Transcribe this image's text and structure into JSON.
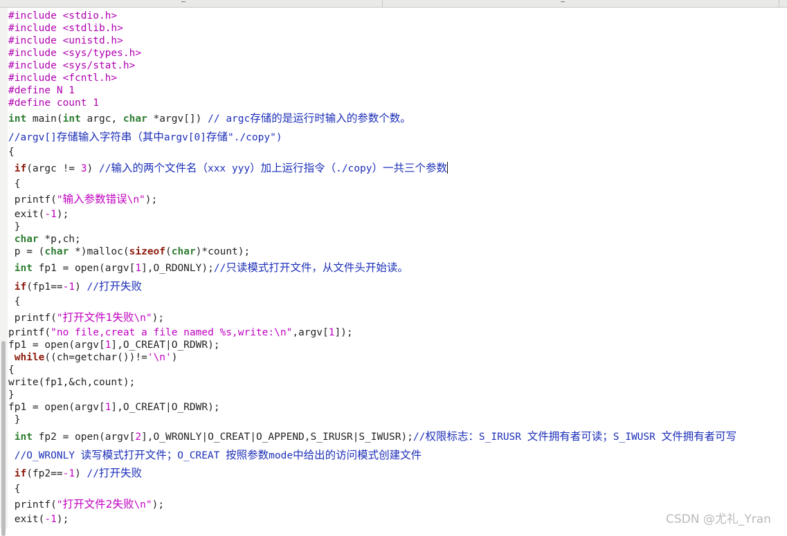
{
  "editor": {
    "lines": {
      "l1": {
        "pp": "#include <stdio.h>"
      },
      "l2": {
        "pp": "#include <stdlib.h>"
      },
      "l3": {
        "pp": "#include <unistd.h>"
      },
      "l4": {
        "pp": "#include <sys/types.h>"
      },
      "l5": {
        "pp": "#include <sys/stat.h>"
      },
      "l6": {
        "pp": "#include <fcntl.h>"
      },
      "l7": {
        "pp": "#define N 1"
      },
      "l8": {
        "pp": "#define count 1"
      },
      "l9": {
        "t1": "int",
        "t2": " main(",
        "t3": "int",
        "t4": " argc, ",
        "t5": "char",
        "t6": " *argv[]) ",
        "c1": "// argc",
        "c2": "存储的是运行时输入的参数个数。"
      },
      "l10": {
        "c1": "//argv[]",
        "c2": "存储输入字符串（其中",
        "c3": "argv[0]",
        "c4": "存储",
        "c5": "\"./copy\")"
      },
      "l11": {
        "t1": "{"
      },
      "l12": {
        "t1": " ",
        "kw": "if",
        "t2": "(argc != ",
        "num": "3",
        "t3": ") ",
        "c1": "//",
        "c2": "输入的两个文件名（",
        "c3": "xxx yyy",
        "c4": "）加上运行指令（",
        "c5": "./copy",
        "c6": "）一共三个参数"
      },
      "l13": {
        "t1": " {"
      },
      "l14": {
        "t1": " printf(",
        "s1": "\"",
        "s2": "输入参数错误",
        "s3": "\\n\"",
        "t2": ");"
      },
      "l15": {
        "t1": " exit(",
        "num": "-1",
        "t2": ");"
      },
      "l16": {
        "t1": " }"
      },
      "l17": {
        "t1": " ",
        "ty": "char",
        "t2": " *p,ch;"
      },
      "l18": {
        "t1": " p = (",
        "ty1": "char",
        "t2": " *)malloc(",
        "kw": "sizeof",
        "t3": "(",
        "ty2": "char",
        "t4": ")*count);"
      },
      "l19": {
        "t1": " ",
        "ty": "int",
        "t2": " fp1 = open(argv[",
        "num": "1",
        "t3": "],O_RDONLY);",
        "c1": "//",
        "c2": "只读模式打开文件，从文件头开始读。"
      },
      "l20": {
        "t1": " ",
        "kw": "if",
        "t2": "(fp1==",
        "num": "-1",
        "t3": ") ",
        "c1": "//",
        "c2": "打开失败"
      },
      "l21": {
        "t1": " {"
      },
      "l22": {
        "t1": " printf(",
        "s1": "\"",
        "s2": "打开文件1失败",
        "s3": "\\n\"",
        "t2": ");"
      },
      "l23": {
        "t1": "printf(",
        "s1": "\"no file,creat a file named %s,write:\\n\"",
        "t2": ",argv[",
        "num": "1",
        "t3": "]);"
      },
      "l24": {
        "t1": "fp1 = open(argv[",
        "num": "1",
        "t2": "],O_CREAT|O_RDWR);"
      },
      "l25": {
        "t1": " ",
        "kw": "while",
        "t2": "((ch=getchar())!=",
        "s1": "'\\n'",
        "t3": ")"
      },
      "l26": {
        "t1": "{"
      },
      "l27": {
        "t1": "write(fp1,&ch,count);"
      },
      "l28": {
        "t1": "}"
      },
      "l29": {
        "t1": "fp1 = open(argv[",
        "num": "1",
        "t2": "],O_CREAT|O_RDWR);"
      },
      "l30": {
        "t1": " }"
      },
      "l31": {
        "t1": " ",
        "ty": "int",
        "t2": " fp2 = open(argv[",
        "num": "2",
        "t3": "],O_WRONLY|O_CREAT|O_APPEND,S_IRUSR|S_IWUSR);",
        "c1": "//",
        "c2": "权限标志：",
        "c3": "S_IRUSR ",
        "c4": "文件拥有者可读；",
        "c5": "S_IWUSR ",
        "c6": "文件拥有者可写"
      },
      "l32": {
        "c1": " //O_WRONLY ",
        "c2": "读写模式打开文件；",
        "c3": "O_CREAT ",
        "c4": "按照参数",
        "c5": "mode",
        "c6": "中给出的访问模式创建文件"
      },
      "l33": {
        "t1": " ",
        "kw": "if",
        "t2": "(fp2==",
        "num": "-1",
        "t3": ") ",
        "c1": "//",
        "c2": "打开失败"
      },
      "l34": {
        "t1": " {"
      },
      "l35": {
        "t1": " printf(",
        "s1": "\"",
        "s2": "打开文件2失败",
        "s3": "\\n\"",
        "t2": ");"
      },
      "l36": {
        "t1": " exit(",
        "num": "-1",
        "t2": ");"
      }
    }
  },
  "watermark": "CSDN @尤礼_Yran"
}
